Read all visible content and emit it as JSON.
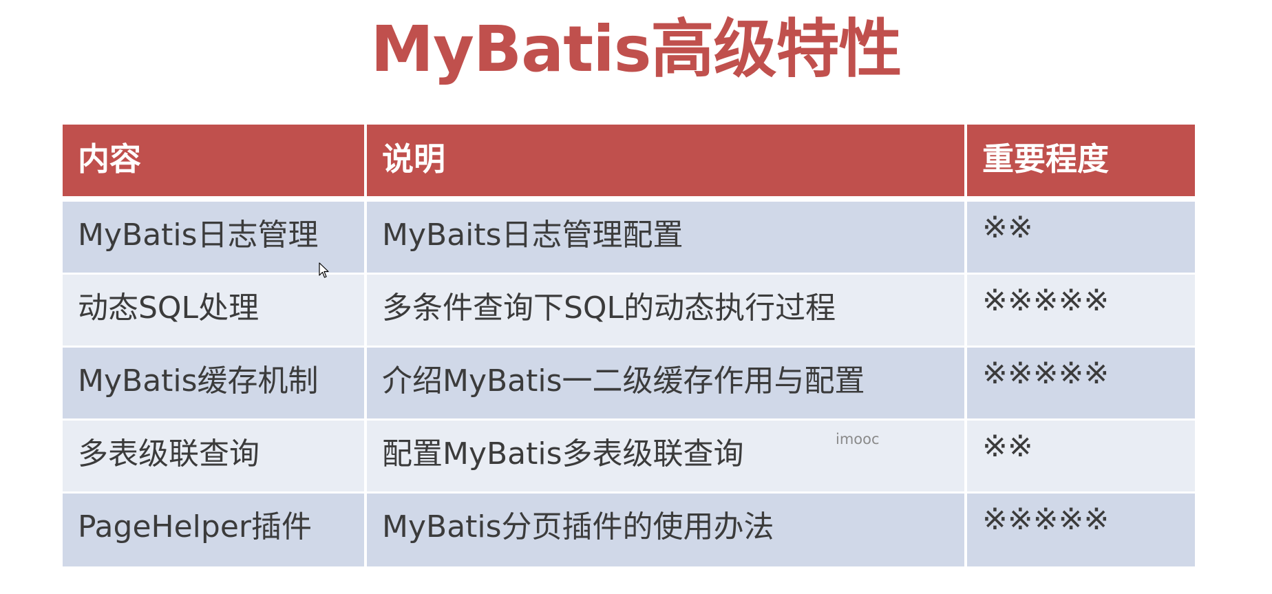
{
  "title": "MyBatis高级特性",
  "colors": {
    "accent": "#c0504d",
    "header_bg": "#c0504d",
    "row_dark": "#d0d8e8",
    "row_light": "#e9edf4",
    "text": "#3b3b3b"
  },
  "table": {
    "headers": [
      "内容",
      "说明",
      "重要程度"
    ],
    "rows": [
      [
        "MyBatis日志管理",
        "MyBaits日志管理配置",
        "※※"
      ],
      [
        "动态SQL处理",
        "多条件查询下SQL的动态执行过程",
        "※※※※※"
      ],
      [
        "MyBatis缓存机制",
        "介绍MyBatis一二级缓存作用与配置",
        "※※※※※"
      ],
      [
        "多表级联查询",
        "配置MyBatis多表级联查询",
        "※※"
      ],
      [
        "PageHelper插件",
        "MyBatis分页插件的使用办法",
        "※※※※※"
      ]
    ]
  },
  "watermark": "imooc",
  "cursor_icon": "mouse-pointer-icon"
}
